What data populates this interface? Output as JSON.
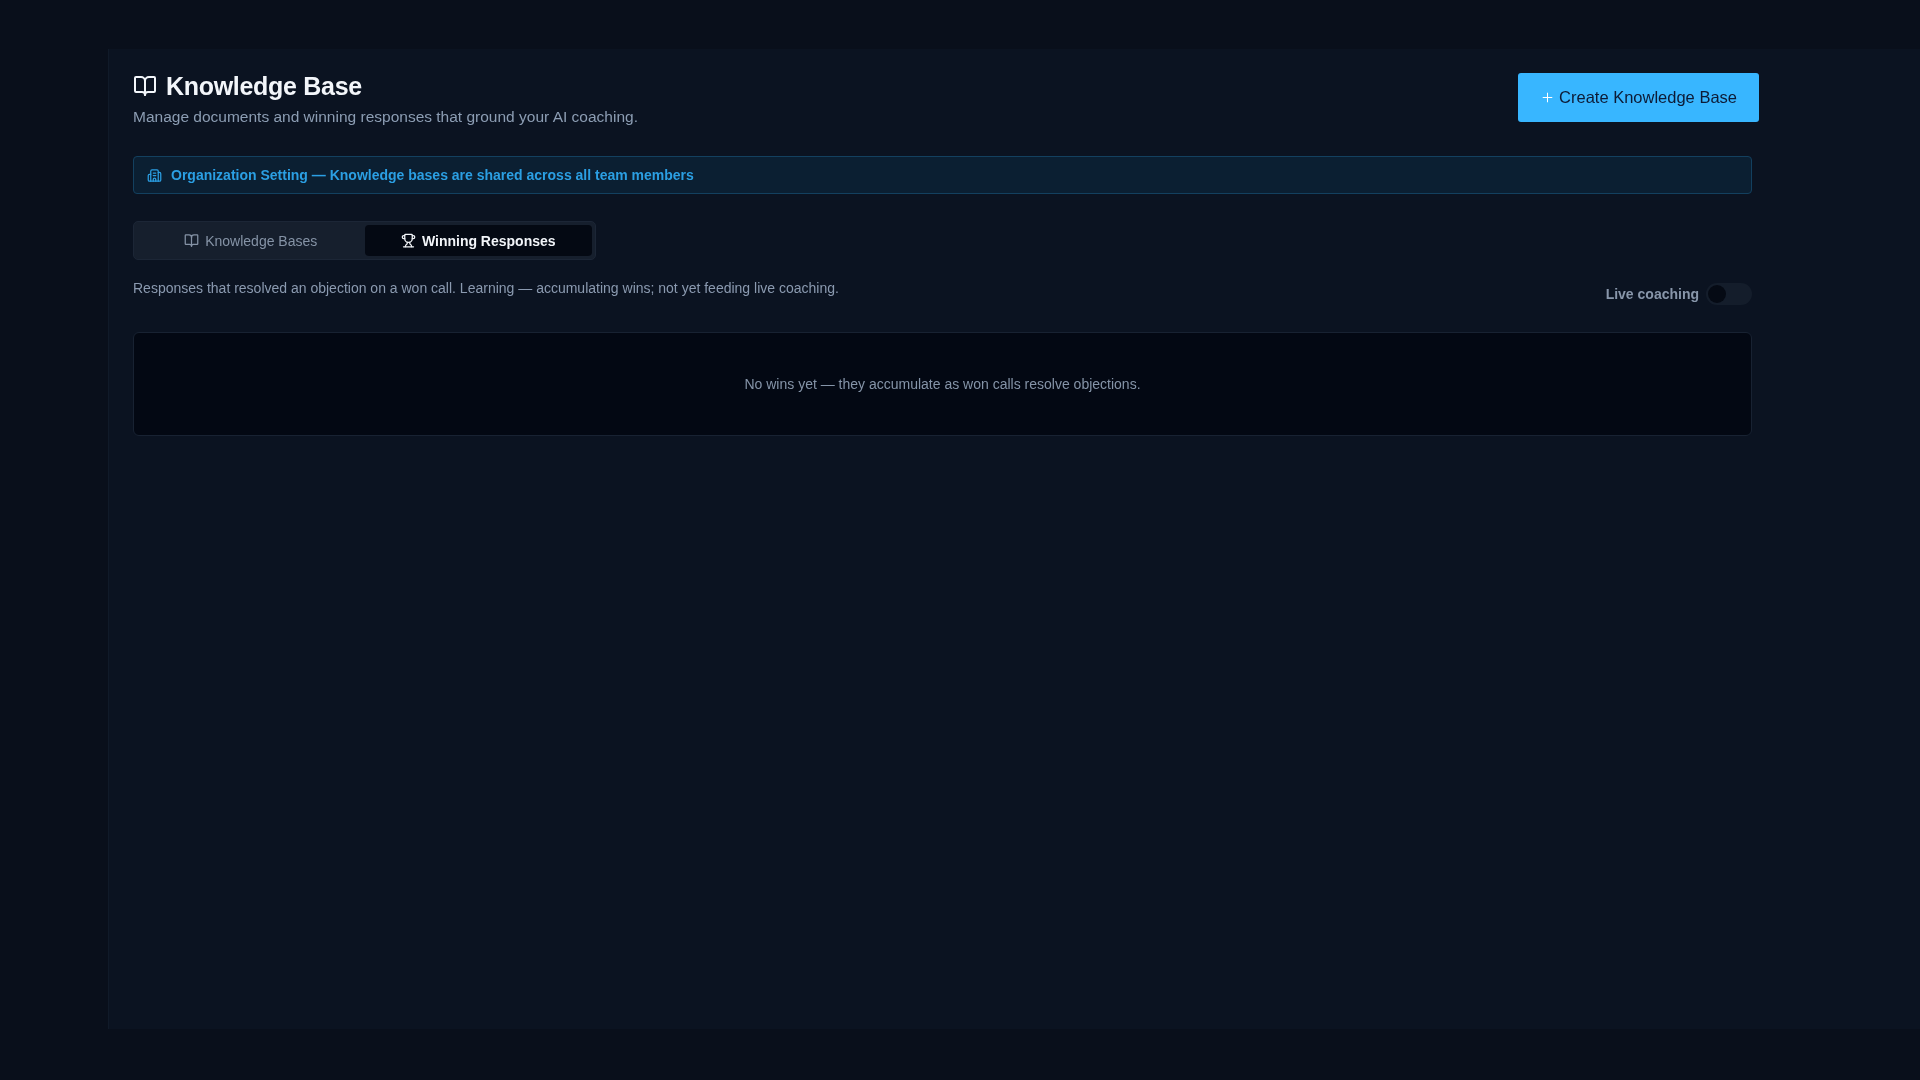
{
  "header": {
    "title": "Knowledge Base",
    "subtitle": "Manage documents and winning responses that ground your AI coaching.",
    "create_button": {
      "label": "Create Knowledge Base"
    }
  },
  "notice": {
    "text": "Organization Setting — Knowledge bases are shared across all team members"
  },
  "tabs": [
    {
      "label": "Knowledge Bases",
      "kind": "book",
      "selected": false
    },
    {
      "label": "Winning Responses",
      "kind": "trophy",
      "selected": true
    }
  ],
  "description": "Responses that resolved an objection on a won call. Learning — accumulating wins; not yet feeding live coaching.",
  "live_coaching": {
    "label": "Live coaching",
    "on": false
  },
  "empty_state": {
    "text": "No wins yet — they accumulate as won calls resolve objections."
  }
}
